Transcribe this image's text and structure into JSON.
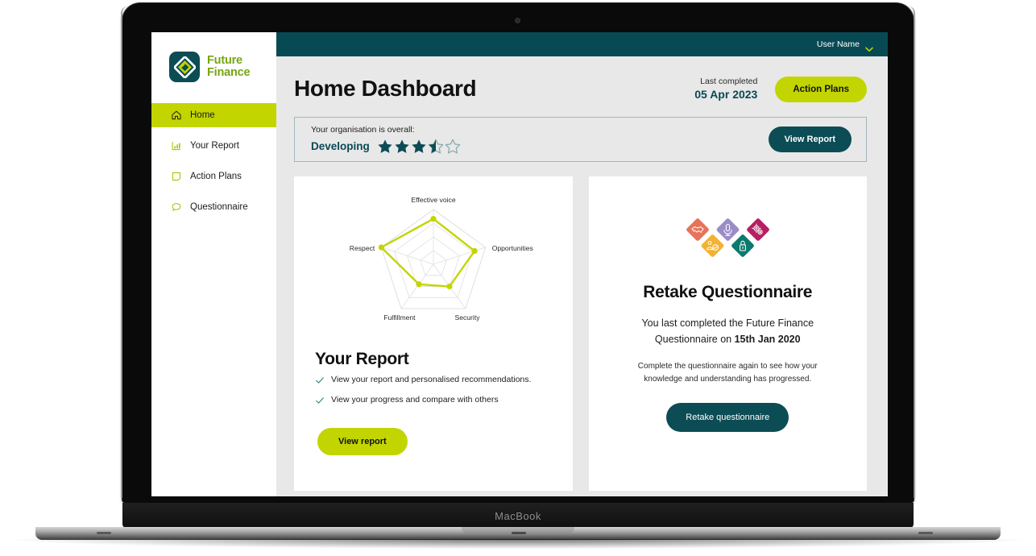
{
  "device": {
    "label": "MacBook",
    "camera_icon": "camera-dot"
  },
  "brand": {
    "line1": "Future",
    "line2": "Finance",
    "logo_icon": "future-finance-diamond-logo",
    "logo_bg": "#0c4c55",
    "logo_accent": "#c2d500"
  },
  "sidebar": {
    "items": [
      {
        "label": "Home",
        "icon": "home-icon",
        "active": true
      },
      {
        "label": "Your Report",
        "icon": "bar-chart-icon",
        "active": false
      },
      {
        "label": "Action Plans",
        "icon": "document-icon",
        "active": false
      },
      {
        "label": "Questionnaire",
        "icon": "speech-bubble-icon",
        "active": false
      }
    ],
    "active_bg": "#c2d500"
  },
  "topbar": {
    "user_name": "User Name",
    "chevron_icon": "chevron-down-icon",
    "bg": "#084a54"
  },
  "header": {
    "title": "Home Dashboard",
    "completed_label": "Last completed",
    "completed_date": "05 Apr 2023",
    "action_plans_label": "Action Plans"
  },
  "rating": {
    "caption": "Your organisation is overall:",
    "level": "Developing",
    "stars_filled": 3,
    "stars_half": 1,
    "stars_total": 5,
    "star_color": "#0c4c55",
    "view_report_label": "View Report"
  },
  "report_card": {
    "heading": "Your Report",
    "bullets": [
      "View your report and personalised recommendations.",
      "View your progress and compare with others"
    ],
    "check_icon": "check-icon",
    "button_label": "View report"
  },
  "retake_card": {
    "heading": "Retake Questionnaire",
    "subtitle_prefix": "You last completed the Future Finance Questionnaire on ",
    "subtitle_date": "15th Jan 2020",
    "note": "Complete the questionnaire again to see how your knowledge and understanding has progressed.",
    "button_label": "Retake questionnaire",
    "diamonds": [
      {
        "icon": "handshake-icon",
        "color": "#e8735a",
        "row": "top",
        "name": "respect"
      },
      {
        "icon": "microphone-icon",
        "color": "#9b8cc8",
        "row": "top",
        "name": "effective-voice"
      },
      {
        "icon": "gears-icon",
        "color": "#b81f63",
        "row": "top",
        "name": "opportunities"
      },
      {
        "icon": "person-check-icon",
        "color": "#f2b233",
        "row": "bottom",
        "name": "fulfillment"
      },
      {
        "icon": "lock-icon",
        "color": "#0c7a6e",
        "row": "bottom",
        "name": "security"
      }
    ]
  },
  "chart_data": {
    "type": "radar",
    "title": "",
    "categories": [
      "Effective voice",
      "Opportunities",
      "Security",
      "Fulfillment",
      "Respect"
    ],
    "values": [
      4.15,
      3.95,
      2.5,
      2.25,
      5.0
    ],
    "rmax": 5,
    "rings": 4,
    "grid": true,
    "legend": "none",
    "line_color": "#c2d500",
    "grid_color": "#e2e2e2",
    "label_color": "#2a2a2a"
  }
}
